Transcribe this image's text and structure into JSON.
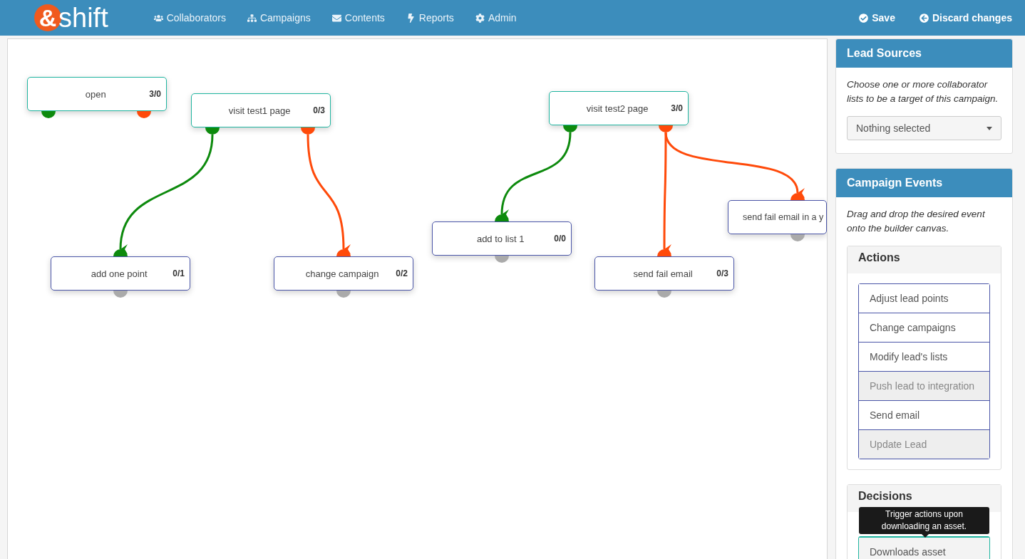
{
  "navbar": {
    "logo": {
      "mark": "&",
      "word": "shift"
    },
    "menu": [
      {
        "label": "Collaborators"
      },
      {
        "label": "Campaigns"
      },
      {
        "label": "Contents"
      },
      {
        "label": "Reports"
      },
      {
        "label": "Admin"
      }
    ],
    "actions": [
      {
        "label": "Save"
      },
      {
        "label": "Discard changes"
      }
    ]
  },
  "canvas": {
    "nodes": [
      {
        "kind": "decision",
        "label": "open",
        "count": "3/0"
      },
      {
        "kind": "decision",
        "label": "visit test1 page",
        "count": "0/3"
      },
      {
        "kind": "action",
        "label": "add one point",
        "count": "0/1"
      },
      {
        "kind": "action",
        "label": "change campaign",
        "count": "0/2"
      },
      {
        "kind": "decision",
        "label": "visit test2 page",
        "count": "3/0"
      },
      {
        "kind": "action",
        "label": "add to list 1",
        "count": "0/0"
      },
      {
        "kind": "action",
        "label": "send fail email",
        "count": "0/3"
      },
      {
        "kind": "action",
        "label": "send fail email in a y"
      }
    ]
  },
  "lead_sources": {
    "title": "Lead Sources",
    "help": "Choose one or more collaborator lists to be a target of this campaign.",
    "select": {
      "placeholder": "Nothing selected"
    }
  },
  "campaign_events": {
    "title": "Campaign Events",
    "help": "Drag and drop the desired event onto the builder canvas.",
    "groups": [
      {
        "title": "Actions",
        "kind": "action",
        "items": [
          {
            "label": "Adjust lead points",
            "disabled": false
          },
          {
            "label": "Change campaigns",
            "disabled": false
          },
          {
            "label": "Modify lead's lists",
            "disabled": false
          },
          {
            "label": "Push lead to integration",
            "disabled": true
          },
          {
            "label": "Send email",
            "disabled": false
          },
          {
            "label": "Update Lead",
            "disabled": true
          }
        ]
      },
      {
        "title": "Decisions",
        "kind": "decision",
        "items": [
          {
            "label": "Downloads asset",
            "tooltip": "Trigger actions upon downloading an asset."
          }
        ]
      }
    ]
  }
}
